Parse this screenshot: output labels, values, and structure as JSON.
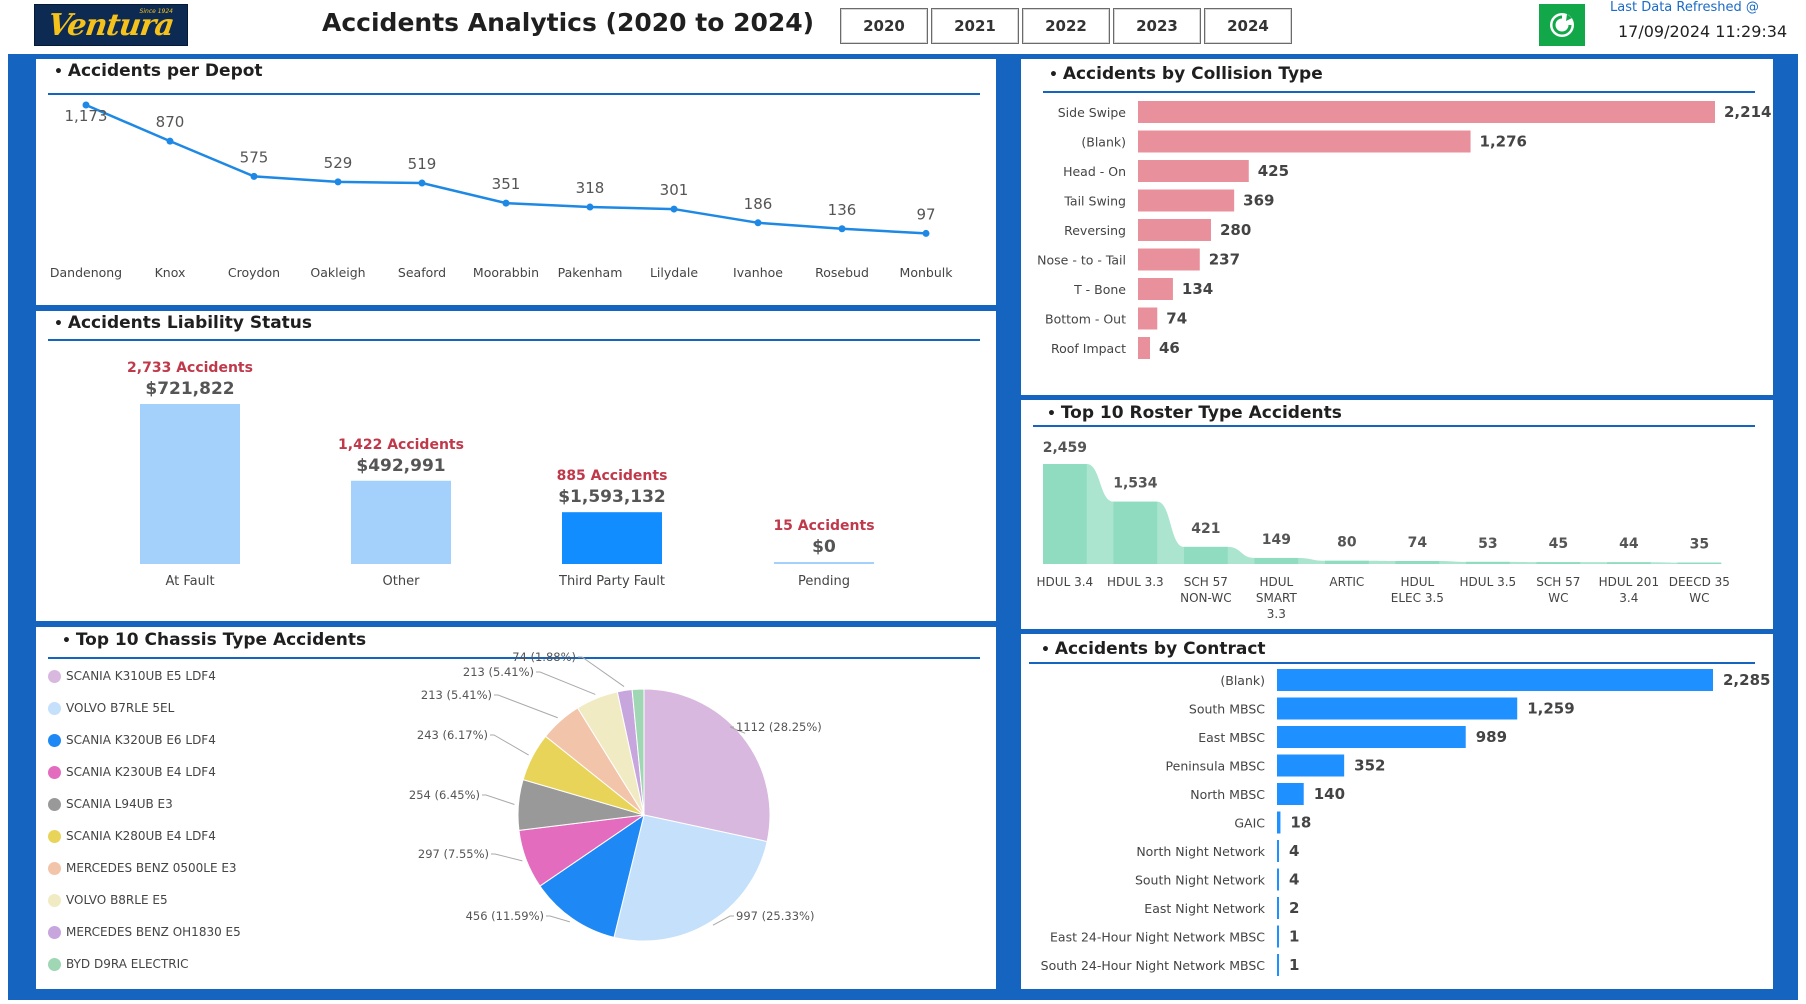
{
  "header": {
    "logo_text": "Ventura",
    "logo_since": "Since 1924",
    "title": "Accidents Analytics (2020 to 2024)",
    "years": [
      "2020",
      "2021",
      "2022",
      "2023",
      "2024"
    ],
    "refresh_label": "Last Data Refreshed @",
    "refresh_time": "17/09/2024 11:29:34",
    "refresh_icon": "refresh-icon"
  },
  "colors": {
    "frame": "#1565c0",
    "line": "#1e88e5",
    "liability_light": "#a3d1fb",
    "liability_dark": "#118dff",
    "accidents_red": "#c0394b",
    "collision_bar": "#e8909b",
    "roster_area": "#8fdcc0",
    "contract_bar": "#1e90ff"
  },
  "chart_data": [
    {
      "id": "depot",
      "type": "line",
      "title": "Accidents per Depot",
      "categories": [
        "Dandenong",
        "Knox",
        "Croydon",
        "Oakleigh",
        "Seaford",
        "Moorabbin",
        "Pakenham",
        "Lilydale",
        "Ivanhoe",
        "Rosebud",
        "Monbulk"
      ],
      "values": [
        1173,
        870,
        575,
        529,
        519,
        351,
        318,
        301,
        186,
        136,
        97
      ],
      "labels": [
        "1,173",
        "870",
        "575",
        "529",
        "519",
        "351",
        "318",
        "301",
        "186",
        "136",
        "97"
      ]
    },
    {
      "id": "liability",
      "type": "bar",
      "title": "Accidents Liability Status",
      "categories": [
        "At Fault",
        "Other",
        "Third Party Fault",
        "Pending"
      ],
      "values": [
        721822,
        492991,
        1593132,
        0
      ],
      "value_labels": [
        "$721,822",
        "$492,991",
        "$1,593,132",
        "$0"
      ],
      "accidents": [
        2733,
        1422,
        885,
        15
      ],
      "accident_labels": [
        "2,733 Accidents",
        "1,422 Accidents",
        "885 Accidents",
        "15 Accidents"
      ]
    },
    {
      "id": "chassis",
      "type": "pie",
      "title": "Top 10 Chassis Type Accidents",
      "categories": [
        "SCANIA K310UB E5 LDF4",
        "VOLVO B7RLE 5EL",
        "SCANIA K320UB E6 LDF4",
        "SCANIA K230UB E4 LDF4",
        "SCANIA L94UB E3",
        "SCANIA K280UB E4 LDF4",
        "MERCEDES BENZ 0500LE E3",
        "VOLVO B8RLE E5",
        "MERCEDES BENZ OH1830 E5",
        "BYD D9RA ELECTRIC"
      ],
      "values": [
        1112,
        997,
        456,
        297,
        254,
        243,
        213,
        213,
        74,
        59
      ],
      "labels": [
        "1112 (28.25%)",
        "997 (25.33%)",
        "456 (11.59%)",
        "297 (7.55%)",
        "254 (6.45%)",
        "243 (6.17%)",
        "213 (5.41%)",
        "213 (5.41%)",
        "74 (1.88%)",
        ""
      ],
      "colors": [
        "#d9b8e0",
        "#c4e0fa",
        "#1e88f5",
        "#e36cbe",
        "#999999",
        "#e9d45a",
        "#f2c4aa",
        "#f1ebc4",
        "#c7a5dd",
        "#9fd6b3"
      ]
    },
    {
      "id": "collision",
      "type": "bar",
      "orientation": "horizontal",
      "title": "Accidents by Collision Type",
      "categories": [
        "Side Swipe",
        "(Blank)",
        "Head - On",
        "Tail Swing",
        "Reversing",
        "Nose - to - Tail",
        "T - Bone",
        "Bottom - Out",
        "Roof Impact"
      ],
      "values": [
        2214,
        1276,
        425,
        369,
        280,
        237,
        134,
        74,
        46
      ],
      "labels": [
        "2,214",
        "1,276",
        "425",
        "369",
        "280",
        "237",
        "134",
        "74",
        "46"
      ]
    },
    {
      "id": "roster",
      "type": "area",
      "title": "Top 10 Roster Type Accidents",
      "categories": [
        "HDUL 3.4",
        "HDUL 3.3",
        "SCH 57 NON-WC",
        "HDUL SMART 3.3",
        "ARTIC",
        "HDUL ELEC 3.5",
        "HDUL 3.5",
        "SCH 57 WC",
        "HDUL 201 3.4",
        "DEECD 35 WC"
      ],
      "category_lines": [
        [
          "HDUL 3.4"
        ],
        [
          "HDUL 3.3"
        ],
        [
          "SCH 57",
          "NON-WC"
        ],
        [
          "HDUL",
          "SMART",
          "3.3"
        ],
        [
          "ARTIC"
        ],
        [
          "HDUL",
          "ELEC 3.5"
        ],
        [
          "HDUL 3.5"
        ],
        [
          "SCH 57",
          "WC"
        ],
        [
          "HDUL 201",
          "3.4"
        ],
        [
          "DEECD 35",
          "WC"
        ]
      ],
      "values": [
        2459,
        1534,
        421,
        149,
        80,
        74,
        53,
        45,
        44,
        35
      ],
      "labels": [
        "2,459",
        "1,534",
        "421",
        "149",
        "80",
        "74",
        "53",
        "45",
        "44",
        "35"
      ]
    },
    {
      "id": "contract",
      "type": "bar",
      "orientation": "horizontal",
      "title": "Accidents by Contract",
      "categories": [
        "(Blank)",
        "South MBSC",
        "East MBSC",
        "Peninsula MBSC",
        "North MBSC",
        "GAIC",
        "North Night Network",
        "South Night Network",
        "East Night Network",
        "East 24-Hour Night Network MBSC",
        "South 24-Hour Night Network MBSC"
      ],
      "values": [
        2285,
        1259,
        989,
        352,
        140,
        18,
        4,
        4,
        2,
        1,
        1
      ],
      "labels": [
        "2,285",
        "1,259",
        "989",
        "352",
        "140",
        "18",
        "4",
        "4",
        "2",
        "1",
        "1"
      ]
    }
  ]
}
